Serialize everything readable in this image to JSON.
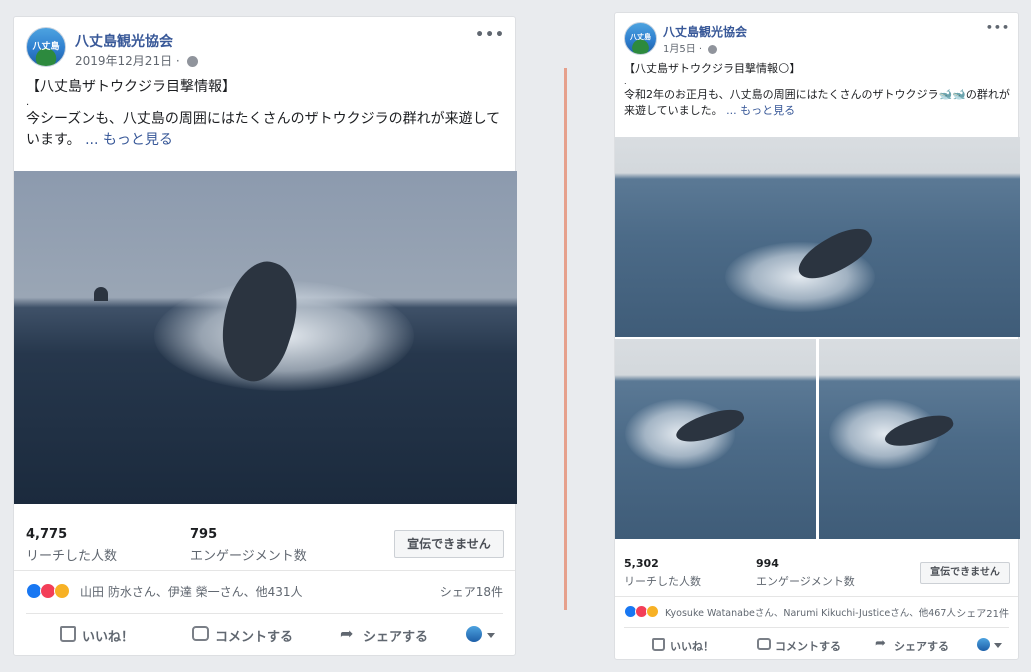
{
  "posts": [
    {
      "page_name": "八丈島観光協会",
      "avatar_text": "八丈島",
      "date": "2019年12月21日 · ",
      "title": "【八丈島ザトウクジラ目撃情報】",
      "dot": ".",
      "body": "今シーズンも、八丈島の周囲にはたくさんのザトウクジラの群れが来遊しています。",
      "more": "... もっと見る",
      "reach_num": "4,775",
      "reach_label": "リーチした人数",
      "engage_num": "795",
      "engage_label": "エンゲージメント数",
      "ad_button": "宣伝できません",
      "reaction_names": "山田 防水さん、伊達 榮一さん、他431人",
      "shares": "シェア18件",
      "like": "いいね！",
      "comment": "コメントする",
      "share": "シェアする"
    },
    {
      "page_name": "八丈島観光協会",
      "avatar_text": "八丈島",
      "date": "1月5日 · ",
      "title": "【八丈島ザトウクジラ目撃情報🌕】",
      "dot": ".",
      "body": "令和2年のお正月も、八丈島の周囲にはたくさんのザトウクジラ🐋🐋の群れが来遊していました。",
      "more": "... もっと見る",
      "reach_num": "5,302",
      "reach_label": "リーチした人数",
      "engage_num": "994",
      "engage_label": "エンゲージメント数",
      "ad_button": "宣伝できません",
      "reaction_names": "Kyosuke Watanabeさん、Narumi Kikuchi-Justiceさん、他467人",
      "shares": "シェア21件",
      "like": "いいね！",
      "comment": "コメントする",
      "share": "シェアする"
    }
  ],
  "icons": {
    "more_menu": "more-options-icon",
    "privacy": "globe-icon",
    "like": "thumbs-up-icon",
    "comment": "comment-icon",
    "share": "share-arrow-icon",
    "reactions": [
      "like-reaction-icon",
      "love-reaction-icon",
      "wow-reaction-icon"
    ]
  },
  "colors": {
    "link": "#385898",
    "accent_divider": "#e6a08c",
    "like_blue": "#1877f2",
    "love_red": "#f33e58",
    "wow_yellow": "#f7b125"
  }
}
